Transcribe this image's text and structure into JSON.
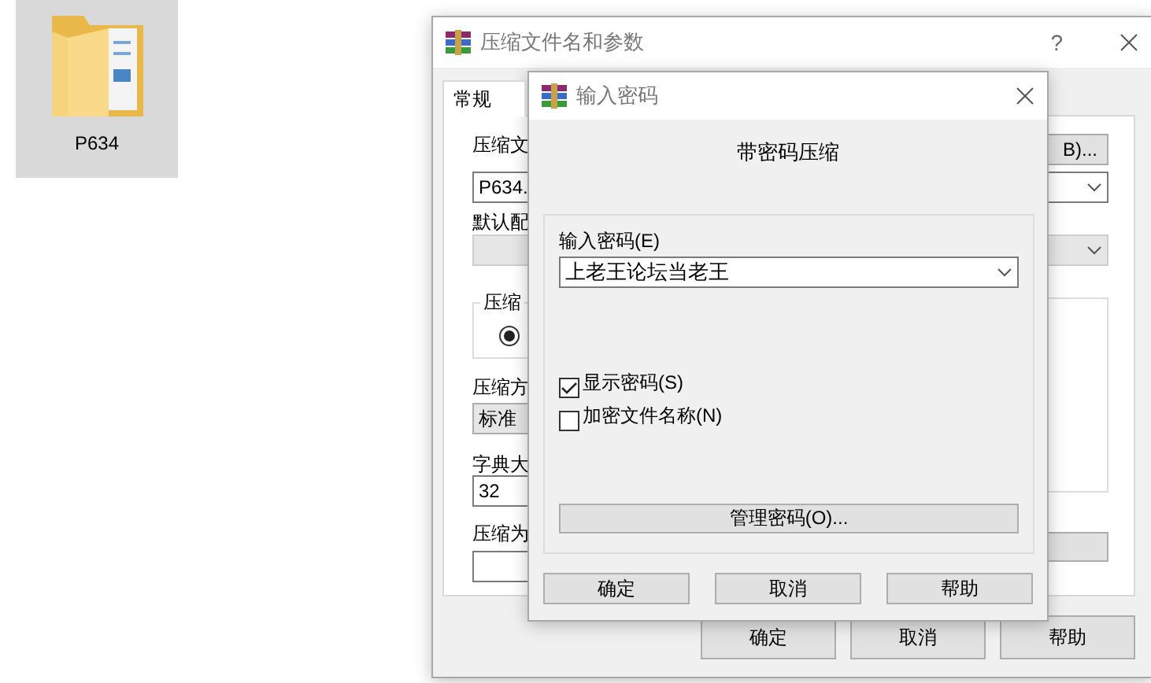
{
  "desktop": {
    "items": [
      {
        "label": "P634",
        "selected": true
      }
    ]
  },
  "archive_dialog": {
    "title": "压缩文件名和参数",
    "help_glyph": "?",
    "tabs": [
      {
        "label": "常规",
        "selected": true
      }
    ],
    "archive_name_label": "压缩文",
    "browse_button": "B)...",
    "archive_name_value": "P634.",
    "profile_label": "默认配",
    "format_group_label": "压缩",
    "format_radio_selected": true,
    "method_label": "压缩方",
    "method_value": "标准",
    "dictionary_label": "字典大",
    "dictionary_value": "32",
    "split_label": "压缩为",
    "buttons": [
      "确定",
      "取消",
      "帮助"
    ]
  },
  "password_dialog": {
    "title": "输入密码",
    "heading": "带密码压缩",
    "password_label": "输入密码(E)",
    "password_value": "上老王论坛当老王",
    "options": [
      {
        "label": "显示密码(S)",
        "checked": true
      },
      {
        "label": "加密文件名称(N)",
        "checked": false
      }
    ],
    "manage_button": "管理密码(O)...",
    "buttons": [
      "确定",
      "取消",
      "帮助"
    ]
  }
}
